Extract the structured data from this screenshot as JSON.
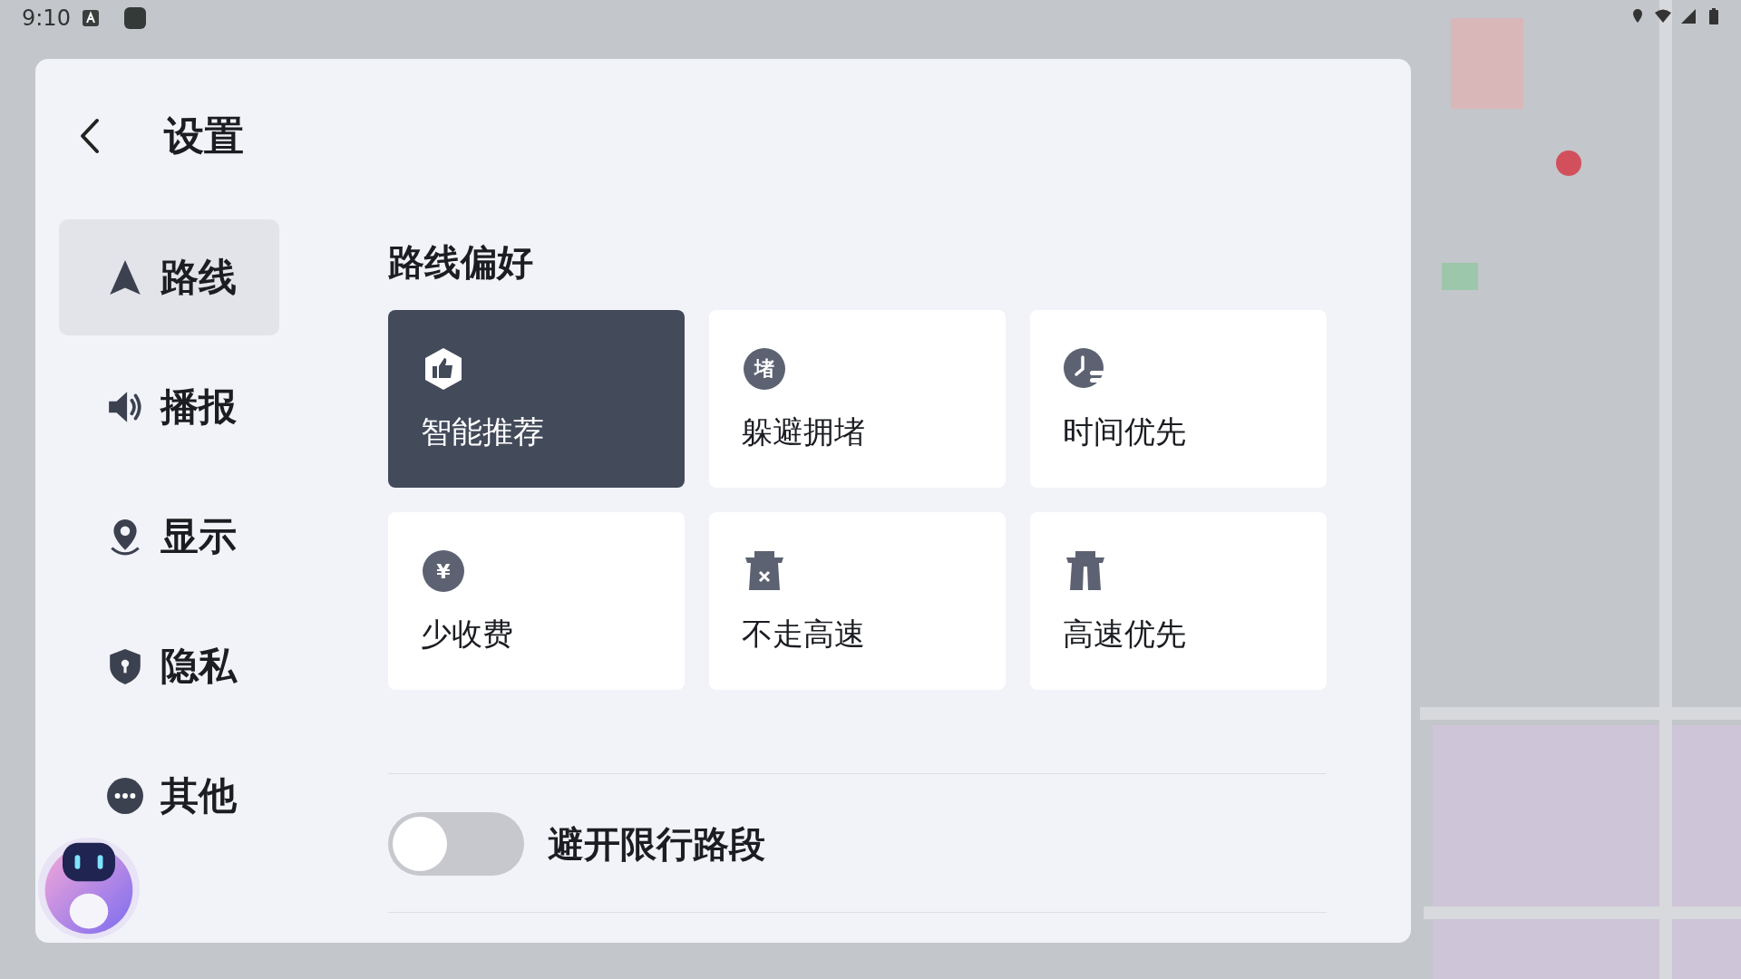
{
  "status_bar": {
    "time": "9:10"
  },
  "header": {
    "title": "设置"
  },
  "sidebar": {
    "items": [
      {
        "label": "路线",
        "selected": true
      },
      {
        "label": "播报",
        "selected": false
      },
      {
        "label": "显示",
        "selected": false
      },
      {
        "label": "隐私",
        "selected": false
      },
      {
        "label": "其他",
        "selected": false
      }
    ]
  },
  "section": {
    "title": "路线偏好"
  },
  "options": [
    {
      "kind": "recommend",
      "label": "智能推荐",
      "selected": true
    },
    {
      "kind": "glyph",
      "glyph": "堵",
      "label": "躲避拥堵",
      "selected": false
    },
    {
      "kind": "clock",
      "label": "时间优先",
      "selected": false
    },
    {
      "kind": "glyph",
      "glyph": "¥",
      "label": "少收费",
      "selected": false
    },
    {
      "kind": "no-highway",
      "label": "不走高速",
      "selected": false
    },
    {
      "kind": "highway",
      "label": "高速优先",
      "selected": false
    }
  ],
  "restriction_toggle": {
    "label": "避开限行路段",
    "on": false
  }
}
